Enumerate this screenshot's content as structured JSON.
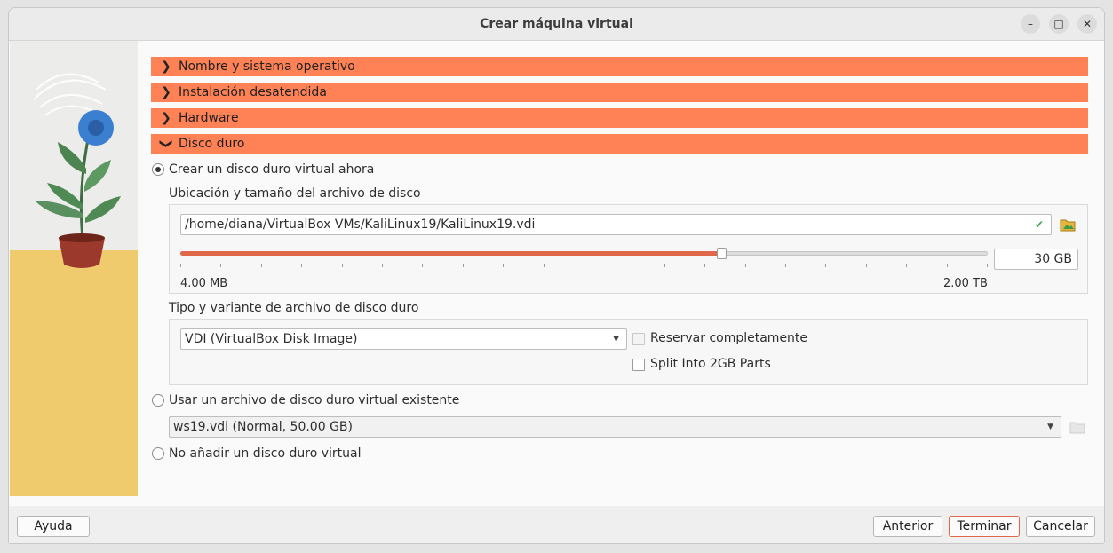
{
  "window": {
    "title": "Crear máquina virtual",
    "controls": [
      "minimize-icon",
      "maximize-icon",
      "close-icon"
    ]
  },
  "sections": [
    {
      "label": "Nombre y sistema operativo",
      "expanded": false
    },
    {
      "label": "Instalación desatendida",
      "expanded": false
    },
    {
      "label": "Hardware",
      "expanded": false
    },
    {
      "label": "Disco duro",
      "expanded": true
    }
  ],
  "disk": {
    "option_create": "Crear un disco duro virtual ahora",
    "location_label": "Ubicación y tamaño del archivo de disco",
    "path_value": "/home/diana/VirtualBox VMs/KaliLinux19/KaliLinux19.vdi",
    "size_value": "30 GB",
    "slider_position": 0.67,
    "slider_min": "4.00 MB",
    "slider_max": "2.00 TB",
    "type_label": "Tipo y variante de archivo de disco duro",
    "type_value": "VDI (VirtualBox Disk Image)",
    "preallocate_label": "Reservar completamente",
    "split_label": "Split Into 2GB Parts",
    "option_existing": "Usar un archivo de disco duro virtual existente",
    "existing_value": "ws19.vdi (Normal, 50.00 GB)",
    "option_none": "No añadir un disco duro virtual",
    "selected_option": "create"
  },
  "footer": {
    "help": "Ayuda",
    "back": "Anterior",
    "finish": "Terminar",
    "cancel": "Cancelar"
  },
  "colors": {
    "section_header": "#ff8256",
    "slider_fill": "#e0674a",
    "sidebar_yellow": "#f0cb6e"
  }
}
